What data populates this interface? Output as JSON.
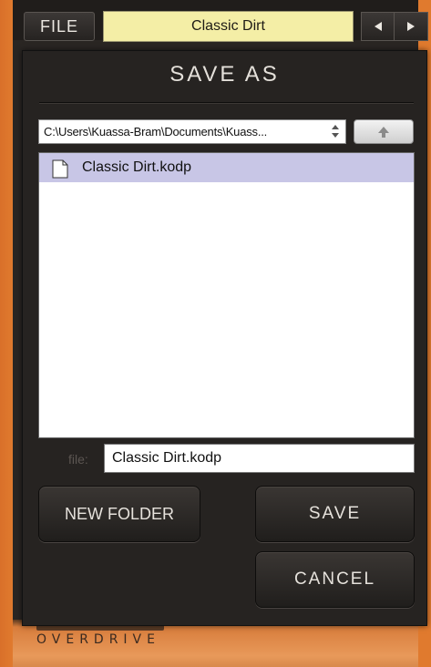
{
  "topbar": {
    "file_label": "FILE",
    "preset_name": "Classic Dirt",
    "prev_icon": "triangle-left-icon",
    "next_icon": "triangle-right-icon"
  },
  "dialog": {
    "title": "SAVE AS",
    "path": "C:\\Users\\Kuassa-Bram\\Documents\\Kuass...",
    "path_icon": "up-down-chevron-icon",
    "up_folder_icon": "arrow-up-icon",
    "files": [
      {
        "name": "Classic Dirt.kodp",
        "icon": "document-icon",
        "selected": true
      }
    ],
    "file_label": "file:",
    "file_value": "Classic Dirt.kodp",
    "new_folder_label": "NEW FOLDER",
    "save_label": "SAVE",
    "cancel_label": "CANCEL"
  },
  "plugin": {
    "brand_sub": "OVERDRIVE"
  },
  "colors": {
    "accent_orange": "#e07a2e",
    "panel_dark": "#262321",
    "selection": "#c8c6e6",
    "preset_display": "#f4eea6"
  }
}
